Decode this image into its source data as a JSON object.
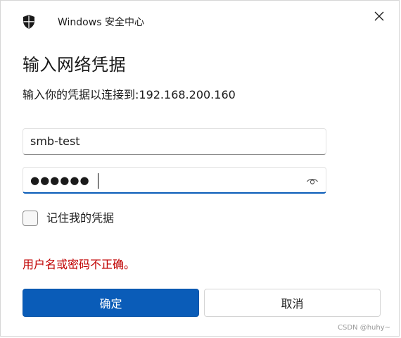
{
  "window": {
    "app_title": "Windows 安全中心",
    "close_icon": "close-icon",
    "shield_icon": "shield-icon"
  },
  "dialog": {
    "heading": "输入网络凭据",
    "subtitle": "输入你的凭据以连接到:192.168.200.160"
  },
  "form": {
    "username_value": "smb-test",
    "password_masked": "●●●●●●",
    "reveal_icon": "eye-icon",
    "remember_label": "记住我的凭据",
    "remember_checked": false,
    "error_message": "用户名或密码不正确。"
  },
  "buttons": {
    "ok_label": "确定",
    "cancel_label": "取消"
  },
  "footer": {
    "watermark": "CSDN @huhy~"
  },
  "colors": {
    "accent": "#0a5cb8",
    "error": "#c00000"
  }
}
